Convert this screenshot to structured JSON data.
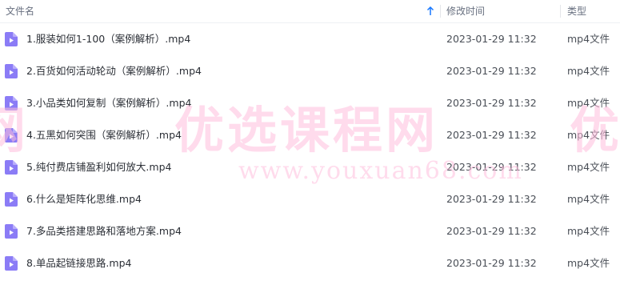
{
  "header": {
    "name_label": "文件名",
    "time_label": "修改时间",
    "type_label": "类型"
  },
  "files": [
    {
      "name": "1.服装如何1-100（案例解析）.mp4",
      "modified": "2023-01-29 11:32",
      "type": "mp4文件",
      "icon": "video-file-icon"
    },
    {
      "name": "2.百货如何活动轮动（案例解析）.mp4",
      "modified": "2023-01-29 11:32",
      "type": "mp4文件",
      "icon": "video-file-icon"
    },
    {
      "name": "3.小品类如何复制（案例解析）.mp4",
      "modified": "2023-01-29 11:32",
      "type": "mp4文件",
      "icon": "video-file-icon"
    },
    {
      "name": "4.五黑如何突围（案例解析）.mp4",
      "modified": "2023-01-29 11:32",
      "type": "mp4文件",
      "icon": "video-file-icon"
    },
    {
      "name": "5.纯付费店铺盈利如何放大.mp4",
      "modified": "2023-01-29 11:32",
      "type": "mp4文件",
      "icon": "video-file-icon"
    },
    {
      "name": "6.什么是矩阵化思维.mp4",
      "modified": "2023-01-29 11:32",
      "type": "mp4文件",
      "icon": "video-file-icon"
    },
    {
      "name": "7.多品类搭建思路和落地方案.mp4",
      "modified": "2023-01-29 11:32",
      "type": "mp4文件",
      "icon": "video-file-icon"
    },
    {
      "name": "8.单品起链接思路.mp4",
      "modified": "2023-01-29 11:32",
      "type": "mp4文件",
      "icon": "video-file-icon"
    }
  ],
  "watermark": {
    "left_fragment": "网",
    "center_text": "优选课程网",
    "right_fragment": "优",
    "url": "www.youxuan68.com"
  },
  "colors": {
    "icon_purple": "#8b7cf6",
    "sort_accent": "#1677ff",
    "watermark_pink": "#ffbedc"
  }
}
